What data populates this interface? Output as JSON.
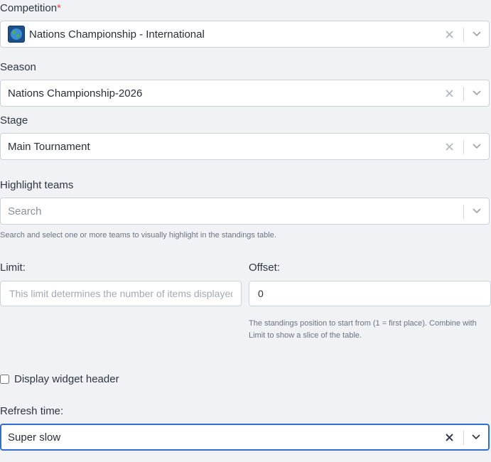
{
  "competition": {
    "label": "Competition",
    "required_mark": "*",
    "value": "Nations Championship - International",
    "icon": "globe-icon"
  },
  "season": {
    "label": "Season",
    "value": "Nations Championship-2026"
  },
  "stage": {
    "label": "Stage",
    "value": "Main Tournament"
  },
  "highlight_teams": {
    "label": "Highlight teams",
    "placeholder": "Search",
    "help": "Search and select one or more teams to visually highlight in the standings table."
  },
  "limit": {
    "label": "Limit:",
    "placeholder": "This limit determines the number of items displayed",
    "value": ""
  },
  "offset": {
    "label": "Offset:",
    "value": "0",
    "help": "The standings position to start from (1 = first place). Combine with Limit to show a slice of the table."
  },
  "display_header": {
    "label": "Display widget header",
    "checked": false
  },
  "refresh_time": {
    "label": "Refresh time:",
    "value": "Super slow"
  },
  "colors": {
    "focus_border": "#2e6fd0",
    "required": "#e5484d",
    "background": "#f0f2f5"
  }
}
